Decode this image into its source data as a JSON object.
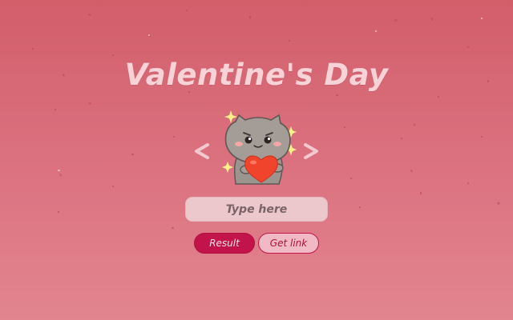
{
  "header": {
    "title": "Valentine's Day"
  },
  "carousel": {
    "prev_icon": "chevron-left-icon",
    "next_icon": "chevron-right-icon",
    "sticker": "cat-holding-heart"
  },
  "input": {
    "placeholder": "Type here",
    "value": ""
  },
  "actions": {
    "result_label": "Result",
    "get_link_label": "Get link"
  },
  "colors": {
    "background_top": "#d25e6a",
    "background_bottom": "#e2858f",
    "title": "#f7d3d8",
    "primary_button": "#c2134a",
    "secondary_button": "#f1b9c4",
    "heart": "#f0442c"
  }
}
